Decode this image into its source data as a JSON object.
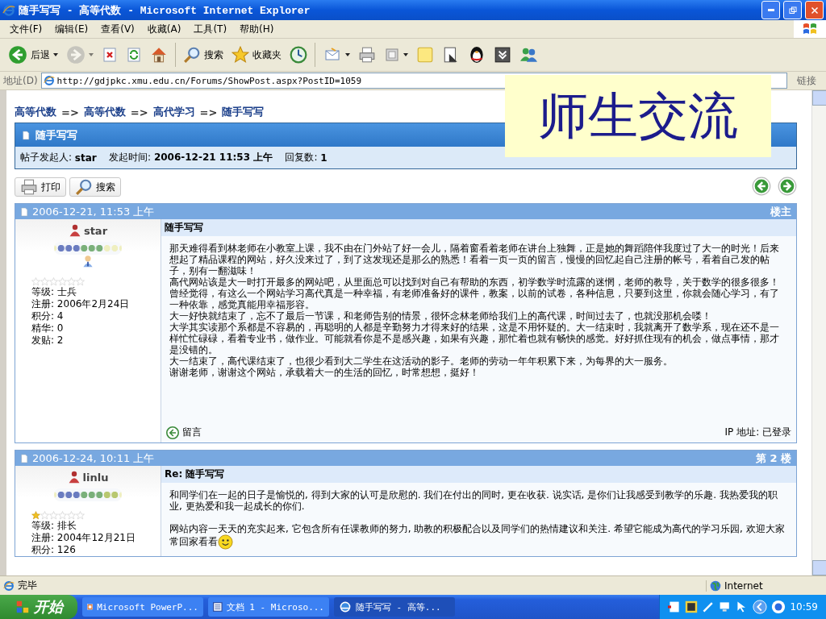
{
  "window": {
    "title": "随手写写 - 高等代数 - Microsoft Internet Explorer"
  },
  "menu": [
    "文件(F)",
    "编辑(E)",
    "查看(V)",
    "收藏(A)",
    "工具(T)",
    "帮助(H)"
  ],
  "toolbar": [
    {
      "kind": "back",
      "label": "后退",
      "dropdown": true,
      "disabled": false
    },
    {
      "kind": "forward",
      "dropdown": true,
      "disabled": true
    },
    {
      "kind": "stop",
      "dropdown": false,
      "disabled": false
    },
    {
      "kind": "refresh",
      "dropdown": false,
      "disabled": false
    },
    {
      "kind": "home",
      "dropdown": false,
      "disabled": false
    },
    {
      "kind": "separator"
    },
    {
      "kind": "search",
      "label": "搜索",
      "dropdown": false,
      "disabled": false
    },
    {
      "kind": "favorites",
      "label": "收藏夹",
      "dropdown": false,
      "disabled": false
    },
    {
      "kind": "history",
      "dropdown": false,
      "disabled": false
    },
    {
      "kind": "separator"
    },
    {
      "kind": "mail",
      "dropdown": true,
      "disabled": false
    },
    {
      "kind": "print",
      "dropdown": false,
      "disabled": false
    },
    {
      "kind": "edit",
      "dropdown": true,
      "disabled": false
    },
    {
      "kind": "note",
      "dropdown": false,
      "disabled": false
    },
    {
      "kind": "research",
      "dropdown": false,
      "disabled": false
    },
    {
      "kind": "penguin",
      "dropdown": false,
      "disabled": false
    },
    {
      "kind": "box",
      "dropdown": false,
      "disabled": false
    },
    {
      "kind": "messenger",
      "dropdown": false,
      "disabled": false
    }
  ],
  "address": {
    "label": "地址(D)",
    "url": "http://gdjpkc.xmu.edu.cn/Forums/ShowPost.aspx?PostID=1059",
    "links": "链接"
  },
  "overlay": {
    "text": "师生交流"
  },
  "breadcrumb": [
    {
      "kind": "link",
      "text": "高等代数"
    },
    {
      "kind": "separator",
      "text": "=>"
    },
    {
      "kind": "link",
      "text": "高等代数"
    },
    {
      "kind": "separator",
      "text": "=>"
    },
    {
      "kind": "link",
      "text": "高代学习"
    },
    {
      "kind": "separator",
      "text": "=>"
    },
    {
      "kind": "link",
      "text": "随手写写"
    }
  ],
  "topic": {
    "title": "随手写写",
    "info": "帖子发起人: **star**    发起时间: **2006-12-21 11:53 上午**    回复数: **1**"
  },
  "actions": [
    {
      "kind": "print",
      "label": "打印"
    },
    {
      "kind": "search",
      "label": "搜索"
    }
  ],
  "posts": [
    {
      "time": "2006-12-21, 11:53 上午",
      "floor": "楼主",
      "user": "star",
      "level": 0.75,
      "avatar": true,
      "stars": 0,
      "stats": [
        "等级: 士兵",
        "注册: 2006年2月24日",
        "积分: 4",
        "精华: 0",
        "发贴: 2"
      ],
      "title": "随手写写",
      "spaced": false,
      "emoticon": false,
      "paragraphs": [
        "那天难得看到林老师在小教室上课，我不由在门外站了好一会儿，隔着窗看着老师在讲台上独舞，正是她的舞蹈陪伴我度过了大一的时光！后来想起了精品课程的网站，好久没来过了，到了这发现还是那么的熟悉！看着一页一页的留言，慢慢的回忆起自己注册的帐号，看着自己发的帖子，别有一翻滋味！",
        "高代网站该是大一时打开最多的网站吧，从里面总可以找到对自己有帮助的东西，初学数学时流露的迷惘，老师的教导，关于数学的很多很多！曾经觉得，有这么一个网站学习高代真是一种幸福，有老师准备好的课件，教案，以前的试卷，各种信息，只要到这里，你就会随心学习，有了一种依靠，感觉真能用幸福形容。",
        "大一好快就结束了，忘不了最后一节课，和老师告别的情景，很怀念林老师给我们上的高代课，时间过去了，也就没那机会喽！",
        "大学其实读那个系都是不容易的，再聪明的人都是辛勤努力才得来好的结果，这是不用怀疑的。大一结束时，我就离开了数学系，现在还不是一样忙忙碌碌，看着专业书，做作业。可能就看你是不是感兴趣，如果有兴趣，那忙着也就有畅快的感觉。好好抓住现有的机会，做点事情，那才是没错的。",
        "大一结束了，高代课结束了，也很少看到大二学生在这活动的影子。老师的劳动一年年积累下来，为每界的大一服务。",
        "谢谢老师，谢谢这个网站，承载着大一的生活的回忆，时常想想，挺好！"
      ],
      "reply": "留言",
      "ip": "IP 地址: 已登录"
    },
    {
      "time": "2006-12-24, 10:11 上午",
      "floor": "第 2 楼",
      "user": "linlu",
      "level": 1,
      "avatar": false,
      "stars": 1,
      "stats": [
        "等级: 排长",
        "注册: 2004年12月21日",
        "积分: 126"
      ],
      "title": "Re: 随手写写",
      "spaced": true,
      "emoticon": true,
      "paragraphs": [
        "和同学们在一起的日子是愉悦的, 得到大家的认可是欣慰的. 我们在付出的同时, 更在收获. 说实话, 是你们让我感受到教学的乐趣. 我热爱我的职业, 更热爱和我一起成长的你们.",
        "网站内容一天天的充实起来, 它包含所有任课教师的努力, 助教的积极配合以及同学们的热情建议和关注. 希望它能成为高代的学习乐园, 欢迎大家常回家看看"
      ]
    }
  ],
  "status": {
    "text": "完毕",
    "zone": "Internet"
  },
  "taskbar": {
    "start": "开始",
    "tasks": [
      {
        "kind": "powerpoint",
        "label": "Microsoft PowerP...",
        "selected": false
      },
      {
        "kind": "word",
        "label": "文档 1 - Microso...",
        "selected": false
      },
      {
        "kind": "browser",
        "label": "随手写写 - 高等...",
        "selected": true
      }
    ],
    "clock": "10:59"
  }
}
